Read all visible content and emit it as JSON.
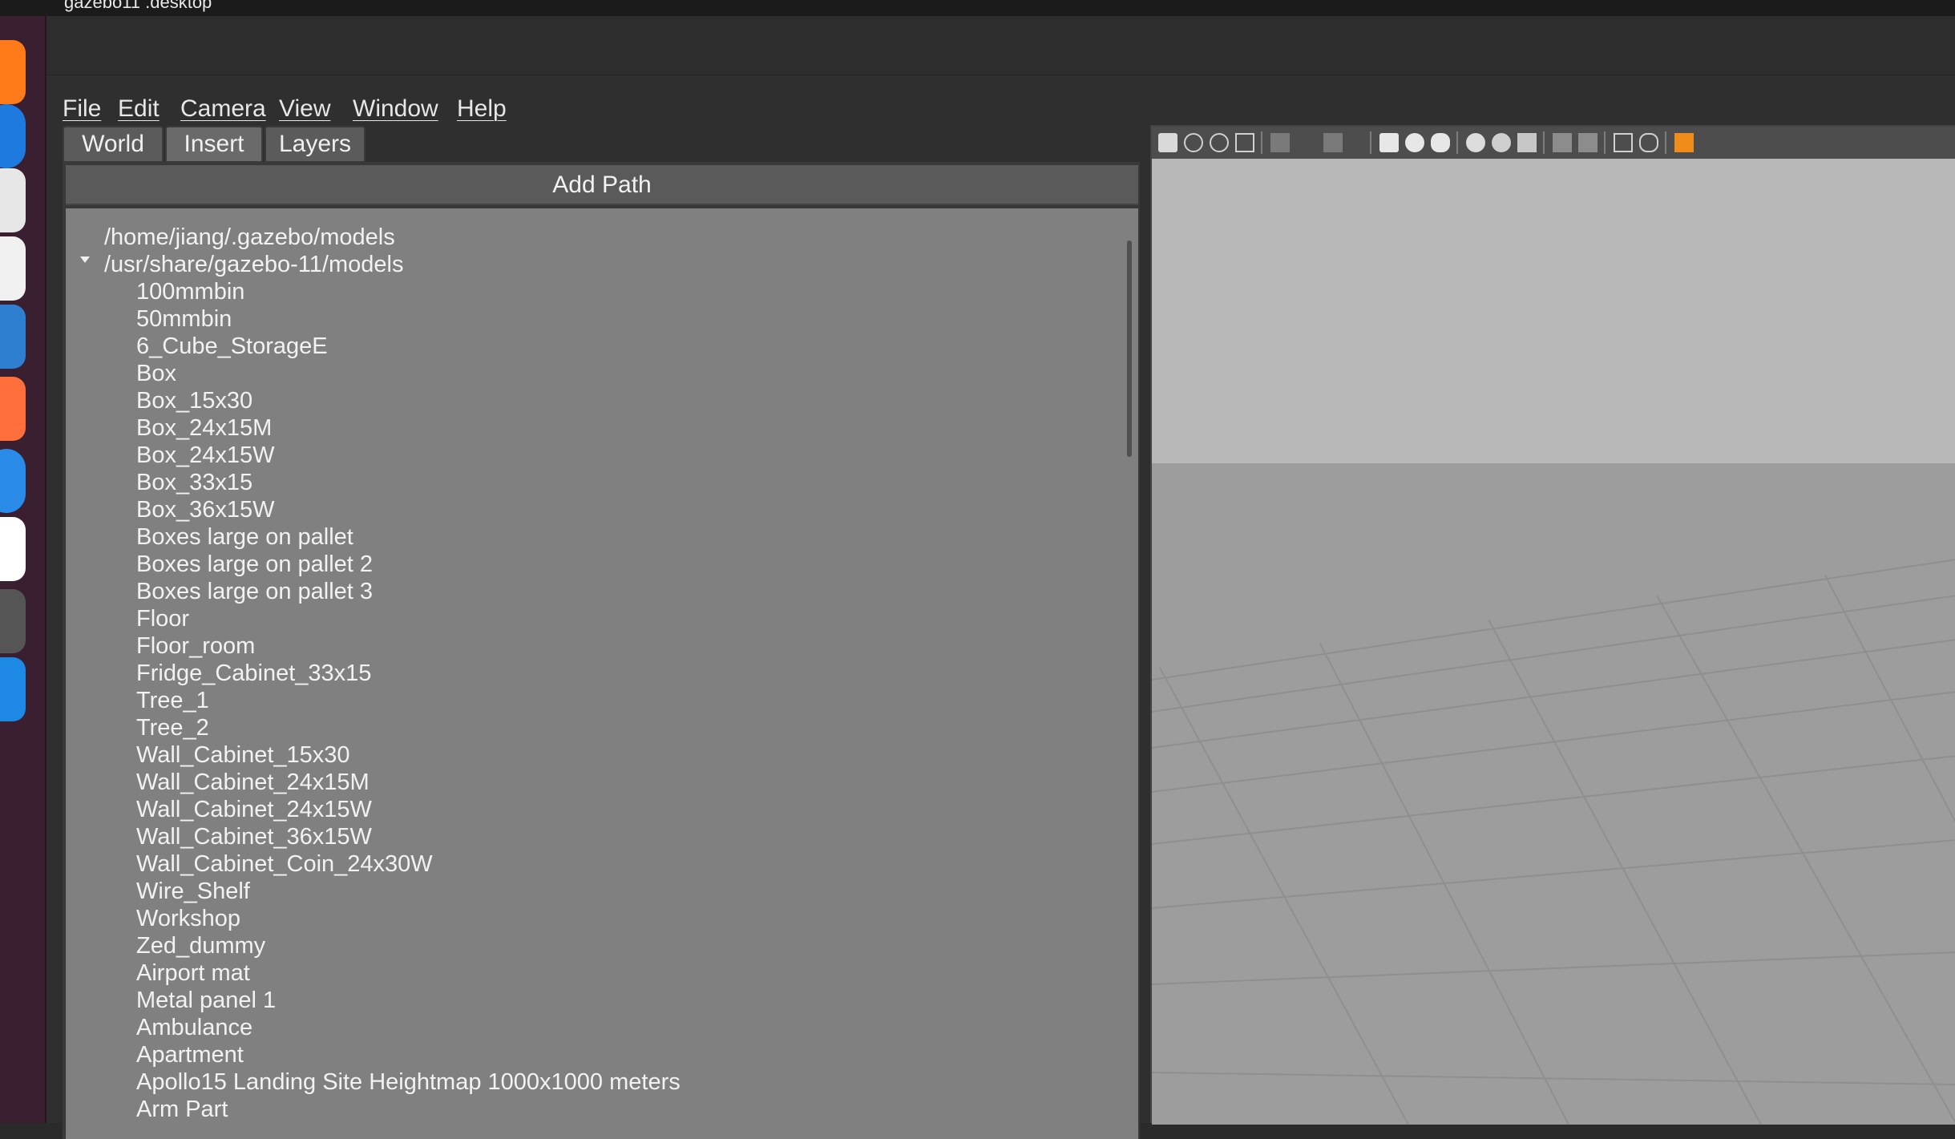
{
  "window": {
    "title": "gazebo11 .desktop"
  },
  "menu": {
    "file": "File",
    "edit": "Edit",
    "camera": "Camera",
    "view": "View",
    "window": "Window",
    "help": "Help"
  },
  "tabs": [
    "World",
    "Insert",
    "Layers"
  ],
  "insert": {
    "add_path": "Add Path",
    "paths": [
      "/home/jiang/.gazebo/models",
      "/usr/share/gazebo-11/models"
    ],
    "models": [
      "100mmbin",
      "50mmbin",
      "6_Cube_StorageE",
      "Box",
      "Box_15x30",
      "Box_24x15M",
      "Box_24x15W",
      "Box_33x15",
      "Box_36x15W",
      "Boxes large on pallet",
      "Boxes large on pallet 2",
      "Boxes large on pallet 3",
      "Floor",
      "Floor_room",
      "Fridge_Cabinet_33x15",
      "Tree_1",
      "Tree_2",
      "Wall_Cabinet_15x30",
      "Wall_Cabinet_24x15M",
      "Wall_Cabinet_24x15W",
      "Wall_Cabinet_36x15W",
      "Wall_Cabinet_Coin_24x30W",
      "Wire_Shelf",
      "Workshop",
      "Zed_dummy",
      "Airport mat",
      "Metal panel 1",
      "Ambulance",
      "Apartment",
      "Apollo15 Landing Site Heightmap 1000x1000 meters",
      "Arm Part"
    ]
  },
  "icons": {
    "dock": [
      "firefox-icon",
      "thunderbird-icon",
      "files-icon",
      "rhythmbox-icon",
      "writer-icon",
      "software-icon",
      "help-icon",
      "amazon-icon",
      "app-icon",
      "vscode-icon"
    ],
    "toolbar": [
      "select-icon",
      "translate-icon",
      "rotate-icon",
      "scale-icon",
      "undo-icon",
      "redo-icon",
      "box-icon",
      "sphere-icon",
      "cylinder-icon",
      "point-light-icon",
      "spot-light-icon",
      "directional-light-icon",
      "copy-icon",
      "paste-icon",
      "align-icon",
      "snap-icon",
      "view-angle-icon"
    ]
  },
  "colors": {
    "dock_bg": "#3a1f30",
    "panel_bg": "#808080",
    "viewport_sky": "#b8b8b8",
    "viewport_ground": "#9d9d9d"
  }
}
